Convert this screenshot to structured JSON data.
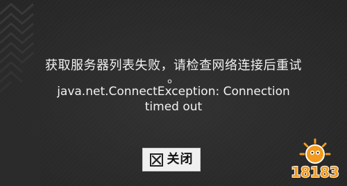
{
  "dialog": {
    "message_cn": "获取服务器列表失败，请检查网络连接后重试",
    "message_period": "。",
    "message_en_line1": "java.net.ConnectException: Connection",
    "message_en_line2": "timed out"
  },
  "close_button": {
    "icon": "close-x-icon",
    "label": "关闭"
  },
  "watermark": {
    "text": "18183",
    "color": "#f39a1c"
  },
  "colors": {
    "background": "#2b2b2b",
    "text": "#f2f2f2",
    "button_bg": "#efefef"
  }
}
